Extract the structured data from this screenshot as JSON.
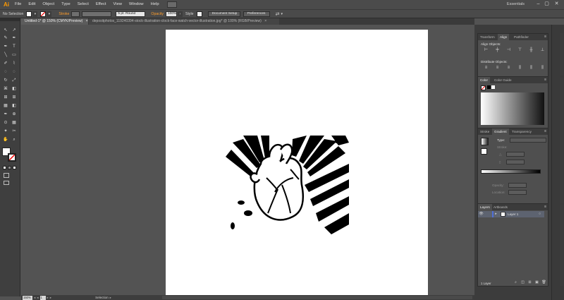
{
  "menubar": {
    "logo": "Ai",
    "items": [
      "File",
      "Edit",
      "Object",
      "Type",
      "Select",
      "Effect",
      "View",
      "Window",
      "Help"
    ],
    "workspace": "Essentials",
    "controls": [
      "–",
      "▢",
      "✕"
    ]
  },
  "controlbar": {
    "selection": "No Selection",
    "stroke_label": "Stroke",
    "brush": "5 pt. Round",
    "opacity_label": "Opacity",
    "opacity_value": "100%",
    "style_label": "Style",
    "document_setup": "Document Setup",
    "preferences": "Preferences"
  },
  "tabs": [
    {
      "label": "Untitled-1* @ 150% (CMYK/Preview)",
      "close": "×"
    },
    {
      "label": "depositphotos_119240394-stock-illustration-clock-face-watch-vector-illustration.jpg* @ 100% (RGB/Preview)",
      "close": "×"
    }
  ],
  "tools": [
    "↖",
    "↗",
    "✎",
    "✒",
    "T",
    "╲",
    "▭",
    "✐",
    "⌇",
    "◌",
    "↻",
    "⤢",
    "⌘",
    "◧",
    "⊞",
    "✦",
    "▦",
    "⊕",
    "⊙",
    "✂",
    "✋",
    "⌕"
  ],
  "statusbar": {
    "zoom": "150%",
    "page": "1",
    "tool": "Selection"
  },
  "panels": {
    "align": {
      "tabs": [
        "Transform",
        "Align",
        "Pathfinder"
      ],
      "align_objects": "Align Objects:",
      "distribute_objects": "Distribute Objects:"
    },
    "color": {
      "tabs": [
        "Color",
        "Color Guide"
      ]
    },
    "gradient": {
      "tabs": [
        "Stroke",
        "Gradient",
        "Transparency"
      ],
      "type_label": "Type:",
      "stroke_label": "Stroke:",
      "angle_label": "△",
      "aspect_label": "▯",
      "opacity_label": "Opacity:",
      "location_label": "Location:"
    },
    "layers": {
      "tabs": [
        "Layers",
        "Artboards"
      ],
      "layer_name": "Layer 1",
      "footer": "1 Layer"
    }
  },
  "colors": {
    "accent": "#ff9a00",
    "panel_bg": "#4f4f4f",
    "canvas_bg": "#535353",
    "layer_color": "#4f6fd8"
  }
}
